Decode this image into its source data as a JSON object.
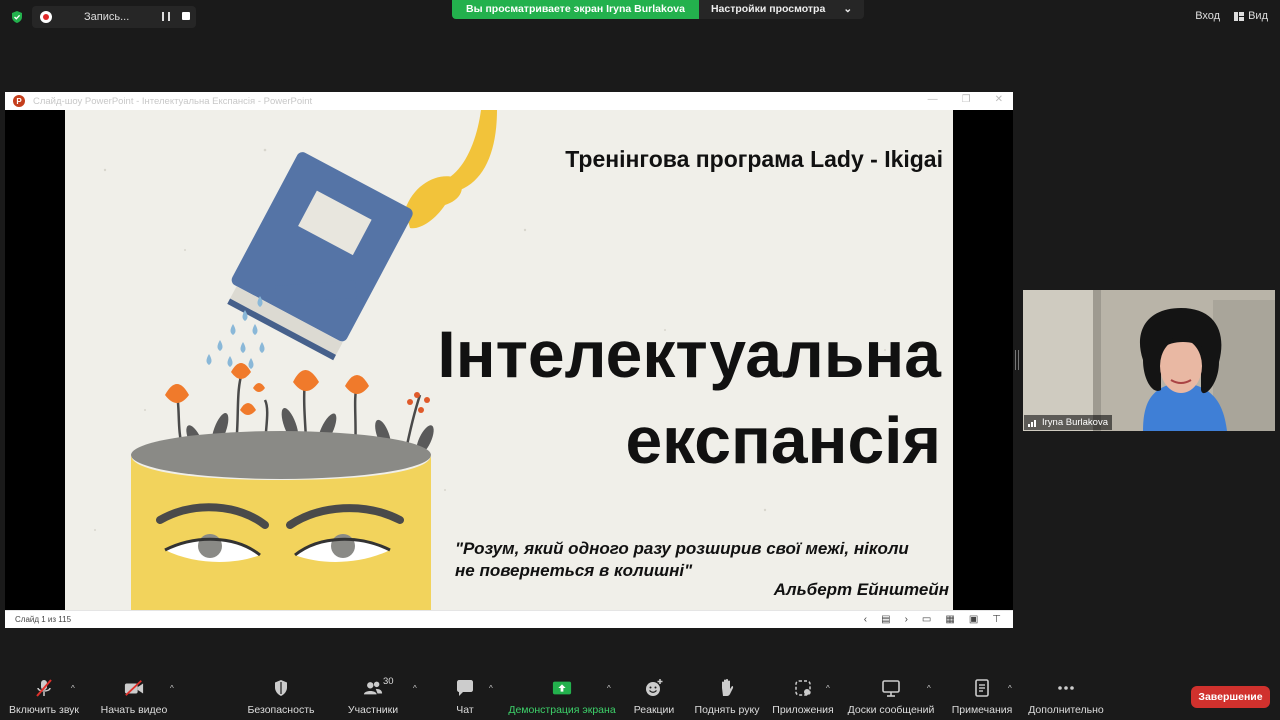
{
  "topbar": {
    "recording_label": "Запись...",
    "share_banner": "Вы просматриваете экран Iryna Burlakova",
    "view_options": "Настройки просмотра",
    "login": "Вход",
    "view": "Вид"
  },
  "powerpoint": {
    "window_title": "Слайд-шоу PowerPoint  -  Інтелектуальна Експансія - PowerPoint",
    "status": "Слайд 1 из 115"
  },
  "slide": {
    "title": "Тренінгова програма Lady - Ikigai",
    "headline_line1": "Інтелектуальна",
    "headline_line2": "експансія",
    "quote_line1": "\"Розум, який одного разу розширив свої межі, ніколи",
    "quote_line2": "не повернеться в колишні\"",
    "author": "Альберт Ейнштейн"
  },
  "participant": {
    "name": "Iryna Burlakova"
  },
  "toolbar": {
    "audio": "Включить звук",
    "video": "Начать видео",
    "security": "Безопасность",
    "participants": "Участники",
    "participants_count": "30",
    "chat": "Чат",
    "share": "Демонстрация экрана",
    "reactions": "Реакции",
    "raise_hand": "Поднять руку",
    "apps": "Приложения",
    "whiteboards": "Доски сообщений",
    "notes": "Примечания",
    "more": "Дополнительно",
    "end": "Завершение"
  },
  "colors": {
    "share_green": "#23b14d",
    "end_red": "#d0312d",
    "slide_bg": "#f0efe9",
    "book_blue": "#5574a6",
    "head_yellow": "#f2d35c",
    "flower_orange": "#f07a2b"
  }
}
